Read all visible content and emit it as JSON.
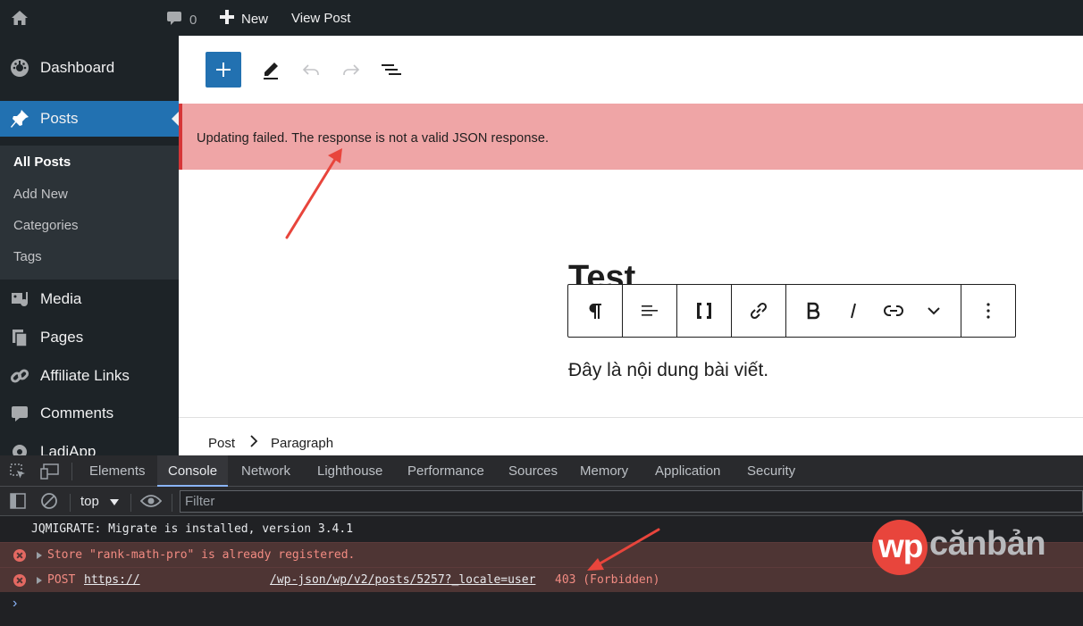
{
  "admin_bar": {
    "home_icon": "home-icon",
    "comments_count": "0",
    "new_label": "New",
    "view_post_label": "View Post"
  },
  "sidebar": {
    "items": [
      {
        "label": "Dashboard",
        "icon": "dashboard-icon"
      },
      {
        "label": "Posts",
        "icon": "pin-icon"
      },
      {
        "label": "Media",
        "icon": "media-icon"
      },
      {
        "label": "Pages",
        "icon": "pages-icon"
      },
      {
        "label": "Affiliate Links",
        "icon": "link-icon"
      },
      {
        "label": "Comments",
        "icon": "comment-icon"
      },
      {
        "label": "LadiApp",
        "icon": "gear-icon"
      }
    ],
    "submenu": [
      "All Posts",
      "Add New",
      "Categories",
      "Tags"
    ]
  },
  "editor": {
    "notice": "Updating failed. The response is not a valid JSON response.",
    "post_title": "Test",
    "paragraph": "Đây là nội dung bài viết.",
    "breadcrumbs": [
      "Post",
      "Paragraph"
    ]
  },
  "devtools": {
    "tabs": [
      "Elements",
      "Console",
      "Network",
      "Lighthouse",
      "Performance",
      "Sources",
      "Memory",
      "Application",
      "Security"
    ],
    "selected_tab": "Console",
    "context": "top",
    "filter_placeholder": "Filter",
    "lines": {
      "info": "JQMIGRATE: Migrate is installed, version 3.4.1",
      "error1": "Store \"rank-math-pro\" is already registered.",
      "error2_method": "POST",
      "error2_url_start": "https://",
      "error2_url_end": "/wp-json/wp/v2/posts/5257?_locale=user",
      "error2_status": "403 (Forbidden)"
    }
  },
  "watermark": {
    "wp": "wp",
    "rest": "cănbản"
  },
  "colors": {
    "admin_dark": "#1d2327",
    "accent_blue": "#2271b1",
    "notice_bg": "#efa5a6",
    "error_text": "#f28b82",
    "arrow_red": "#e8453c"
  }
}
